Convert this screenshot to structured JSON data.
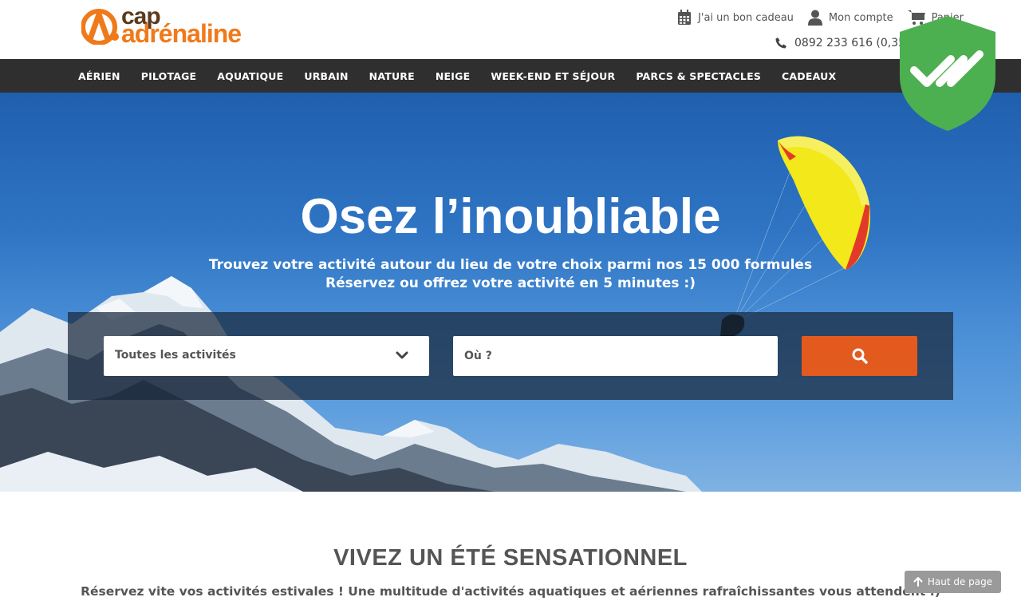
{
  "header": {
    "logo_top": "cap",
    "logo_bottom": "adrénaline",
    "gift_label": "J'ai un bon cadeau",
    "account_label": "Mon compte",
    "cart_label": "Panier",
    "phone": "0892 233 616 (0,35€",
    "icons": [
      "calendar-icon",
      "user-icon",
      "cart-icon",
      "phone-icon"
    ]
  },
  "nav": {
    "items": [
      "AÉRIEN",
      "PILOTAGE",
      "AQUATIQUE",
      "URBAIN",
      "NATURE",
      "NEIGE",
      "WEEK-END ET SÉJOUR",
      "PARCS & SPECTACLES",
      "CADEAUX"
    ]
  },
  "hero": {
    "title": "Osez l’inoubliable",
    "subtitle_1": "Trouvez votre activité autour du lieu de votre choix parmi nos 15 000 formules",
    "subtitle_2": "Réservez ou offrez votre activité en 5 minutes :)",
    "search": {
      "activity_selected": "Toutes les activités",
      "where_placeholder": "Où ?"
    }
  },
  "section": {
    "title": "VIVEZ UN ÉTÉ SENSATIONNEL",
    "text": "Réservez vite vos activités estivales ! Une multitude d'activités aquatiques et aériennes rafraîchissantes vous attendent :)"
  },
  "back_to_top": "Haut de page",
  "colors": {
    "brand_orange": "#f07a1a",
    "brand_brown": "#5b3a1e",
    "nav_bg": "#2f2f2f",
    "search_button": "#e35a1f",
    "shield_green": "#4caf50"
  }
}
